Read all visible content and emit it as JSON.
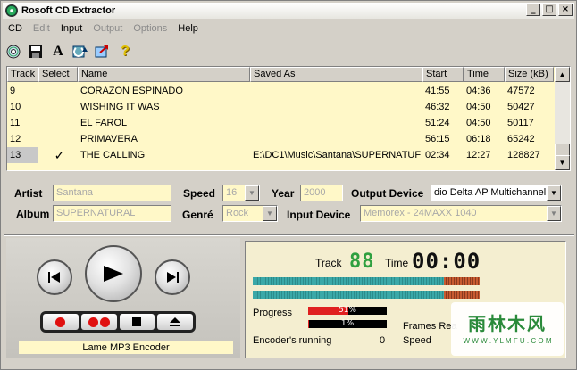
{
  "window": {
    "title": "Rosoft CD Extractor"
  },
  "title_buttons": {
    "minimize": "_",
    "maximize": "□",
    "close": "×"
  },
  "menu": [
    {
      "label": "CD",
      "enabled": true
    },
    {
      "label": "Edit",
      "enabled": false
    },
    {
      "label": "Input",
      "enabled": true
    },
    {
      "label": "Output",
      "enabled": false
    },
    {
      "label": "Options",
      "enabled": false
    },
    {
      "label": "Help",
      "enabled": true
    }
  ],
  "toolbar": {
    "icons": [
      "cd-icon",
      "save-icon",
      "font-icon",
      "refresh-icon",
      "export-icon",
      "help-icon"
    ],
    "font_glyph": "A",
    "help_glyph": "?"
  },
  "tracks": {
    "columns": [
      "Track",
      "Select",
      "Name",
      "Saved As",
      "Start",
      "Time",
      "Size (kB)"
    ],
    "rows": [
      {
        "track": "9",
        "select": "",
        "name": "CORAZON ESPINADO",
        "saved_as": "",
        "start": "41:55",
        "time": "04:36",
        "size": "47572"
      },
      {
        "track": "10",
        "select": "",
        "name": "WISHING IT WAS",
        "saved_as": "",
        "start": "46:32",
        "time": "04:50",
        "size": "50427"
      },
      {
        "track": "11",
        "select": "",
        "name": "EL FAROL",
        "saved_as": "",
        "start": "51:24",
        "time": "04:50",
        "size": "50117"
      },
      {
        "track": "12",
        "select": "",
        "name": "PRIMAVERA",
        "saved_as": "",
        "start": "56:15",
        "time": "06:18",
        "size": "65242"
      },
      {
        "track": "13",
        "select": "✓",
        "name": "THE CALLING",
        "saved_as": "E:\\DC1\\Music\\Santana\\SUPERNATUF",
        "start": "02:34",
        "time": "12:27",
        "size": "128827"
      }
    ],
    "selected_index": 4
  },
  "props": {
    "artist_label": "Artist",
    "artist_value": "Santana",
    "album_label": "Album",
    "album_value": "SUPERNATURAL",
    "speed_label": "Speed",
    "speed_value": "16",
    "genre_label": "Genré",
    "genre_value": "Rock",
    "year_label": "Year",
    "year_value": "2000",
    "output_device_label": "Output Device",
    "output_device_value": "dio Delta AP Multichannel",
    "input_device_label": "Input Device",
    "input_device_value": "Memorex - 24MAXX 1040"
  },
  "player": {
    "encoder": "Lame MP3 Encoder"
  },
  "status": {
    "track_label": "Track",
    "track_value": "88",
    "time_label": "Time",
    "time_value": "00:00",
    "progress_label": "Progress",
    "progress1_text": "51%",
    "progress1_value": 0.51,
    "progress2_text": "1%",
    "progress2_value": 0.01,
    "frames_label": "Frames Rea",
    "encoder_label": "Encoder's running",
    "encoder_value": "0",
    "speed_label": "Speed"
  },
  "watermark": {
    "line1": "雨林木风",
    "line2": "W W W . Y L M F U . C O M"
  },
  "colors": {
    "panel": "#fff8c8",
    "segment_green": "#2fa040",
    "record_red": "#e01010"
  }
}
